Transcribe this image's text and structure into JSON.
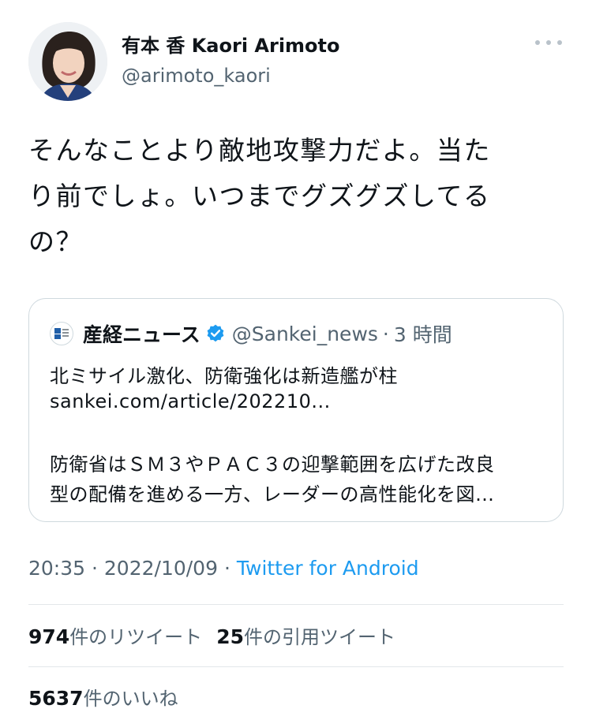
{
  "author": {
    "display_name": "有本 香 Kaori Arimoto",
    "handle": "@arimoto_kaori"
  },
  "icons": {
    "more": "more-options-icon",
    "verified": "verified-badge-icon",
    "source_logo": "sankei-logo-icon"
  },
  "tweet": {
    "lines": [
      "そんなことより敵地攻撃力だよ。当た",
      "り前でしょ。いつまでグズグズしてる",
      "の？"
    ]
  },
  "quoted_tweet": {
    "name": "産経ニュース",
    "handle": "@Sankei_news",
    "separator": "·",
    "time": "3 時間",
    "headline": "北ミサイル激化、防衛強化は新造艦が柱",
    "link": "sankei.com/article/202210...",
    "body_lines": [
      "防衛省はＳＭ３やＰＡＣ３の迎撃範囲を広げた改良",
      "型の配備を進める一方、レーダーの高性能化を図…"
    ]
  },
  "meta": {
    "time": "20:35",
    "date": "2022/10/09",
    "separator": "·",
    "source": "Twitter for Android"
  },
  "stats": {
    "retweets_count": "974",
    "retweets_label": "件のリツイート",
    "quotes_count": "25",
    "quotes_label": "件の引用ツイート",
    "likes_count": "5637",
    "likes_label": "件のいいね"
  },
  "colors": {
    "link": "#1d9bf0",
    "secondary_text": "#536471",
    "border": "#cfd9de"
  }
}
